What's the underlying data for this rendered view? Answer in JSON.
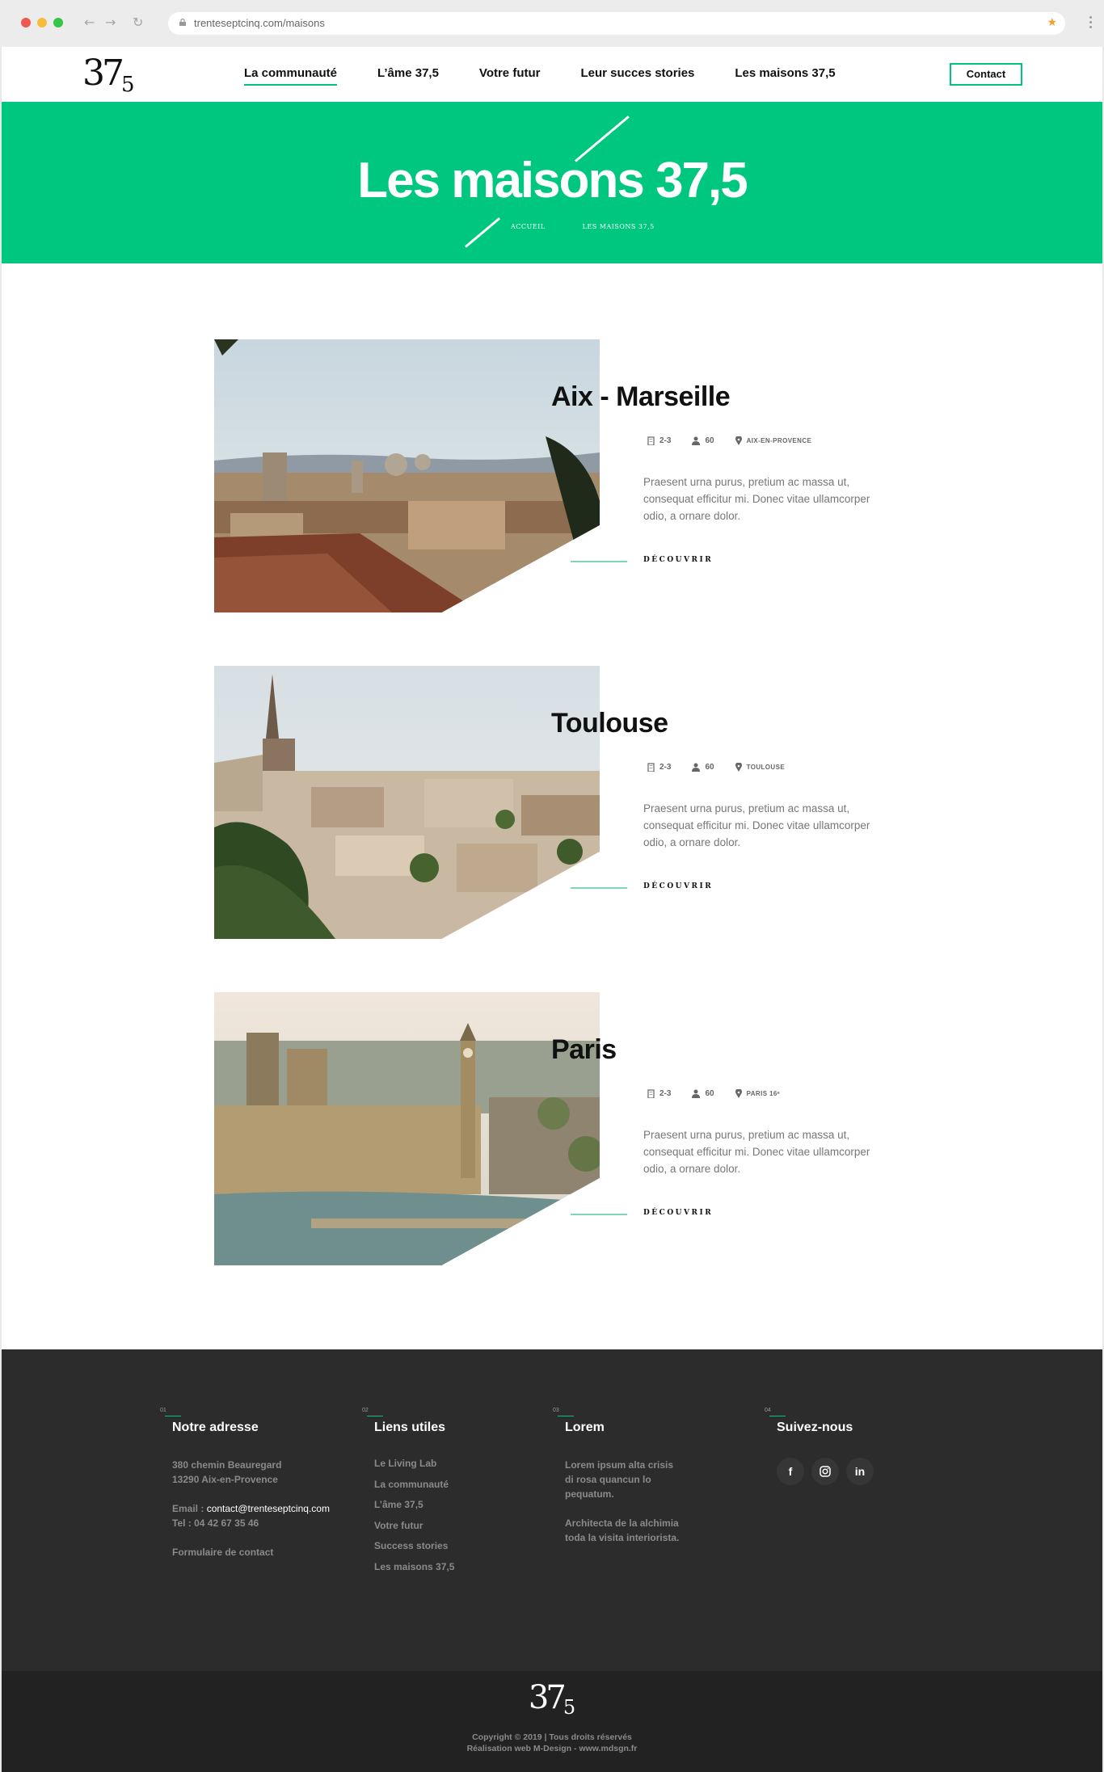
{
  "browser": {
    "url": "trenteseptcinq.com/maisons"
  },
  "logo": {
    "main": "37",
    "sub": "5"
  },
  "nav": {
    "items": [
      "La communauté",
      "L’âme 37,5",
      "Votre futur",
      "Leur succes stories",
      "Les maisons 37,5"
    ],
    "contact": "Contact"
  },
  "hero": {
    "title": "Les maisons 37,5",
    "breadcrumb": [
      "ACCUEIL",
      "LES MAISONS 37,5"
    ]
  },
  "houses": [
    {
      "name": "Aix - Marseille",
      "rooms": "2-3",
      "people": "60",
      "location": "AIX-EN-PROVENCE",
      "description": "Praesent urna purus, pretium ac massa ut, consequat efficitur mi. Donec vitae ullamcorper odio, a ornare dolor.",
      "cta": "DÉCOUVRIR"
    },
    {
      "name": "Toulouse",
      "rooms": "2-3",
      "people": "60",
      "location": "TOULOUSE",
      "description": "Praesent urna purus, pretium ac massa ut, consequat efficitur mi. Donec vitae ullamcorper odio, a ornare dolor.",
      "cta": "DÉCOUVRIR"
    },
    {
      "name": "Paris",
      "rooms": "2-3",
      "people": "60",
      "location": "PARIS 16ᵉ",
      "description": "Praesent urna purus, pretium ac massa ut, consequat efficitur mi. Donec vitae ullamcorper odio, a ornare dolor.",
      "cta": "DÉCOUVRIR"
    }
  ],
  "footer": {
    "address": {
      "num": "01",
      "title": "Notre adresse",
      "line1": "380 chemin Beauregard",
      "line2": "13290 Aix-en-Provence",
      "email_label": "Email : ",
      "email": "contact@trenteseptcinq.com",
      "tel": "Tel : 04 42 67 35 46",
      "form": "Formulaire de contact"
    },
    "links": {
      "num": "02",
      "title": "Liens utiles",
      "items": [
        "Le Living Lab",
        "La communauté",
        "L’âme 37,5",
        "Votre futur",
        "Success stories",
        "Les maisons 37,5"
      ]
    },
    "lorem": {
      "num": "03",
      "title": "Lorem",
      "p1": [
        "Lorem ipsum alta crisis",
        "di rosa quancun lo",
        "pequatum."
      ],
      "p2": [
        "Architecta de la alchimia",
        "toda la visita interiorista."
      ]
    },
    "social": {
      "num": "04",
      "title": "Suivez-nous",
      "icons": [
        "facebook-icon",
        "instagram-icon",
        "linkedin-icon"
      ]
    },
    "copyright": "Copyright © 2019  |  Tous droits réservés",
    "credit": "Réalisation web M-Design - www.mdsgn.fr"
  },
  "colors": {
    "accent": "#00c77f",
    "footer": "#2c2c2c",
    "subfooter": "#222222"
  }
}
